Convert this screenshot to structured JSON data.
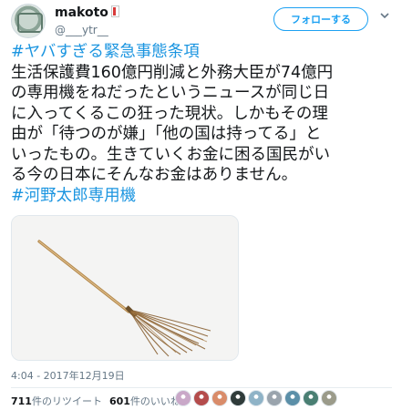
{
  "author": {
    "display_name": "makoto",
    "handle": "@___ytr__",
    "follow_label": "フォローする"
  },
  "tweet": {
    "lines": [
      [
        "#ヤバすぎる緊急事態条項"
      ],
      [
        "生活保護費160億円削減と外務大臣が74億円"
      ],
      [
        "の専用機をねだったというニュースが同じ日"
      ],
      [
        "に入ってくるこの狂った現状。しかもその理"
      ],
      [
        "由が「待つのが嫌」「他の国は持ってる」と"
      ],
      [
        "いったもの。生きていくお金に困る国民がい"
      ],
      [
        "る今の日本にそんなお金はありません。"
      ],
      [
        "#河野太郎専用機"
      ]
    ],
    "hashtag_color": "#1b95e0",
    "image_subject": "broom",
    "timestamp": "4:04 - 2017年12月19日"
  },
  "stats": {
    "retweets_count": "711",
    "retweets_label": "件のリツイート",
    "likes_count": "601",
    "likes_label": "件のいいね"
  },
  "likers": [
    {
      "color": "#c9a8c8"
    },
    {
      "color": "#b44c4c"
    },
    {
      "color": "#d98c6a"
    },
    {
      "color": "#2f3b3a"
    },
    {
      "color": "#8fb3c7"
    },
    {
      "color": "#9aa4ad"
    },
    {
      "color": "#5b8fa8"
    },
    {
      "color": "#4a7f73"
    },
    {
      "color": "#9b9b8a"
    }
  ],
  "colors": {
    "accent": "#1da1f2",
    "muted": "#657786"
  }
}
